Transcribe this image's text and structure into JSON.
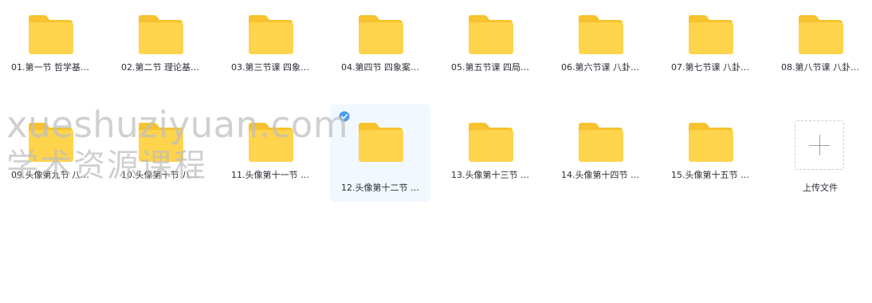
{
  "files": [
    {
      "name": "01.第一节 哲学基…"
    },
    {
      "name": "02.第二节 理论基…"
    },
    {
      "name": "03.第三节课 四象…"
    },
    {
      "name": "04.第四节 四象案…"
    },
    {
      "name": "05.第五节课 四局…"
    },
    {
      "name": "06.第六节课 八卦…"
    },
    {
      "name": "07.第七节课 八卦…"
    },
    {
      "name": "08.第八节课 八卦…"
    },
    {
      "name": "09.头像第九节 八…"
    },
    {
      "name": "10.头像第十节 八…"
    },
    {
      "name": "11.头像第十一节 …"
    },
    {
      "name": "12.头像第十二节 …",
      "selected": true
    },
    {
      "name": "13.头像第十三节 …"
    },
    {
      "name": "14.头像第十四节 …"
    },
    {
      "name": "15.头像第十五节 …"
    }
  ],
  "upload": {
    "label": "上传文件"
  },
  "watermark": {
    "line1": "xueshuziyuan.com",
    "line2": "学术资源课程"
  },
  "colors": {
    "folder_front": "#ffd44d",
    "folder_back": "#f6c22e",
    "selected_bg": "#f1f8ff",
    "check": "#4a9df4"
  }
}
